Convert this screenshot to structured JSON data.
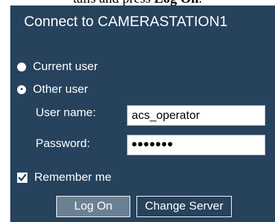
{
  "caption": {
    "prefix": "tails and press ",
    "emphasis": "Log On",
    "suffix": "."
  },
  "dialog": {
    "title": "Connect to CAMERASTATION1",
    "options": {
      "current_user": "Current user",
      "other_user": "Other user",
      "selected": "other_user"
    },
    "username": {
      "label": "User name:",
      "value": "acs_operator"
    },
    "password": {
      "label": "Password:",
      "masked_value": "•••••••"
    },
    "remember_me": {
      "label": "Remember me",
      "checked": true
    },
    "buttons": {
      "log_on": "Log On",
      "change_server": "Change Server"
    }
  },
  "colors": {
    "panel_background": "#26425d",
    "primary_button_background": "#6c8094",
    "text": "#ffffff"
  }
}
